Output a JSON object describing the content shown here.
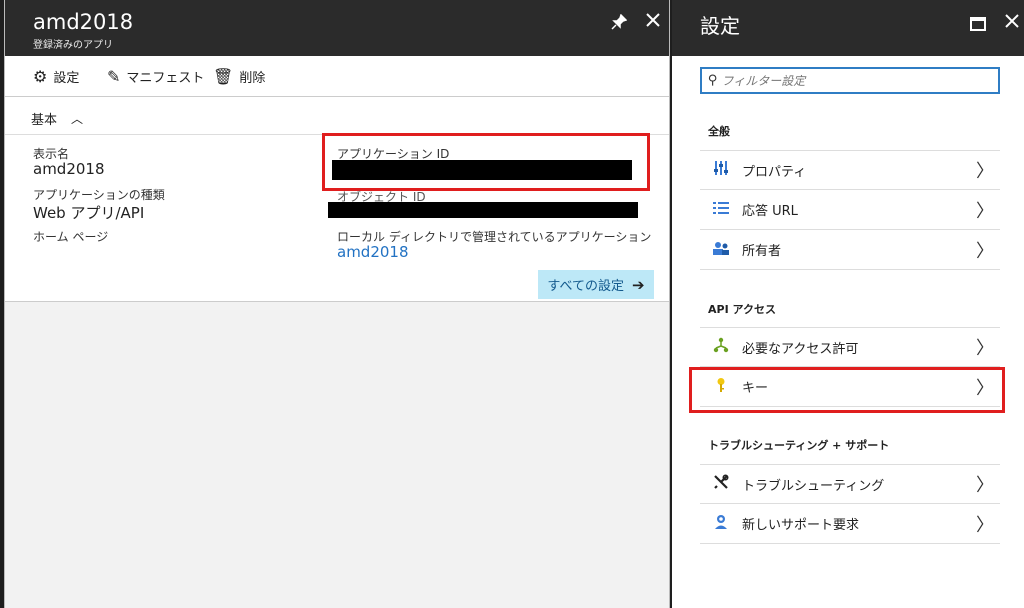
{
  "app_blade": {
    "title": "amd2018",
    "subtitle": "登録済みのアプリ",
    "pin_icon": "pin-icon",
    "close_icon": "close-icon",
    "toolbar": {
      "settings_label": "設定",
      "manifest_label": "マニフェスト",
      "delete_label": "削除"
    },
    "essentials": {
      "header": "基本",
      "display_name_label": "表示名",
      "display_name_value": "amd2018",
      "app_type_label": "アプリケーションの種類",
      "app_type_value": "Web アプリ/API",
      "homepage_label": "ホーム ページ",
      "app_id_label": "アプリケーション ID",
      "object_id_label": "オブジェクト ID",
      "local_dir_label": "ローカル ディレクトリで管理されているアプリケーション",
      "local_dir_link": "amd2018",
      "all_settings_label": "すべての設定"
    }
  },
  "settings_blade": {
    "title": "設定",
    "filter_placeholder": "フィルター設定",
    "sections": {
      "general": "全般",
      "api_access": "API アクセス",
      "troubleshooting": "トラブルシューティング + サポート"
    },
    "items": {
      "properties": "プロパティ",
      "reply_url": "応答 URL",
      "owners": "所有者",
      "required_permissions": "必要なアクセス許可",
      "keys": "キー",
      "troubleshoot": "トラブルシューティング",
      "new_support": "新しいサポート要求"
    }
  },
  "colors": {
    "header_bg": "#2b2b2b",
    "accent": "#2272c3",
    "highlight_red": "#e01e1e",
    "button_bg": "#bde8f7"
  }
}
